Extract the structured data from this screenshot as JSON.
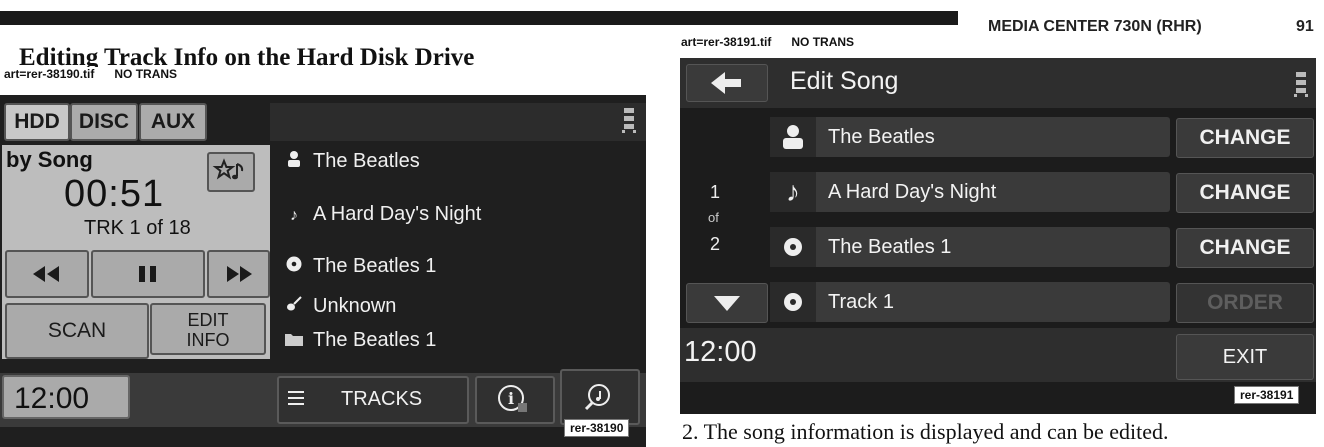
{
  "header": {
    "text": "MEDIA CENTER 730N (RHR)",
    "page_number": "91"
  },
  "section_title": "Editing Track Info on the Hard Disk Drive",
  "left_figure": {
    "art_label": "art=rer-38190.tif      NO TRANS",
    "ref": "rer-38190",
    "tabs": [
      "HDD",
      "DISC",
      "AUX"
    ],
    "mode": "by Song",
    "time": "00:51",
    "track_counter": "TRK 1 of 18",
    "scan_label": "SCAN",
    "edit_info_label": "EDIT INFO",
    "clock": "12:00",
    "tracks_label": "TRACKS",
    "info": [
      {
        "icon": "person-icon",
        "text": "The Beatles"
      },
      {
        "icon": "music-note-icon",
        "text": "A Hard Day's Night"
      },
      {
        "icon": "disc-icon",
        "text": "The Beatles 1"
      },
      {
        "icon": "guitar-icon",
        "text": "Unknown"
      },
      {
        "icon": "folder-icon",
        "text": "The Beatles 1"
      }
    ]
  },
  "right_figure": {
    "art_label": "art=rer-38191.tif      NO TRANS",
    "ref": "rer-38191",
    "title": "Edit Song",
    "page_current": "1",
    "page_of": "of",
    "page_total": "2",
    "change_label": "CHANGE",
    "order_label": "ORDER",
    "exit_label": "EXIT",
    "clock": "12:00",
    "rows": [
      {
        "icon": "person-icon",
        "text": "The Beatles"
      },
      {
        "icon": "music-note-icon",
        "text": "A Hard Day's Night"
      },
      {
        "icon": "disc-icon",
        "text": "The Beatles 1"
      },
      {
        "icon": "disc-icon",
        "text": "Track 1"
      }
    ]
  },
  "caption": "2.  The song information is displayed and can be edited."
}
